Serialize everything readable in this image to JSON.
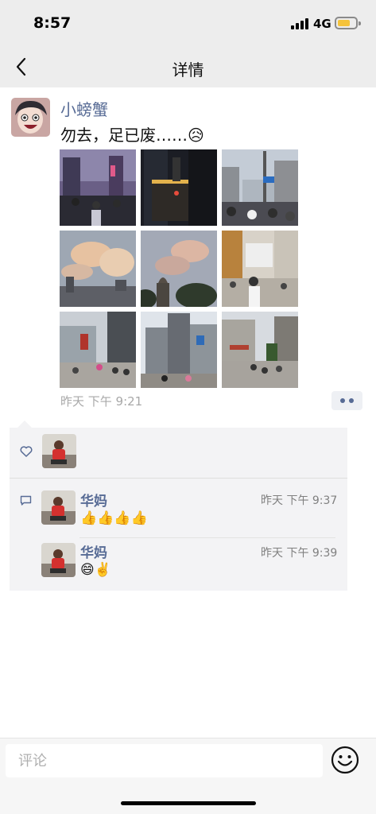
{
  "status_bar": {
    "time": "8:57",
    "network": "4G"
  },
  "nav": {
    "title": "详情",
    "back_icon": "chevron-left-icon"
  },
  "post": {
    "username": "小螃蟹",
    "text": "勿去，足已废……",
    "text_emoji": "😥",
    "time": "昨天 下午 9:21",
    "photos": [
      "street-crowd-night",
      "tower-night",
      "street-crowd-day",
      "cloudy-sky-1",
      "cloudy-sky-2",
      "pedestrian-street-1",
      "shopping-street-1",
      "shopping-street-2",
      "shopping-street-3"
    ]
  },
  "likes": {
    "icon": "heart-outline-icon",
    "users": [
      "华妈"
    ]
  },
  "comments": [
    {
      "name": "华妈",
      "time": "昨天 下午 9:37",
      "text": "👍👍👍👍"
    },
    {
      "name": "华妈",
      "time": "昨天 下午 9:39",
      "text": "😄✌️"
    }
  ],
  "comment_bar": {
    "placeholder": "评论",
    "emoji_icon": "smiley-icon"
  },
  "colors": {
    "link_blue": "#576b95",
    "panel_bg": "#f3f3f5",
    "nav_bg": "#ededed"
  }
}
